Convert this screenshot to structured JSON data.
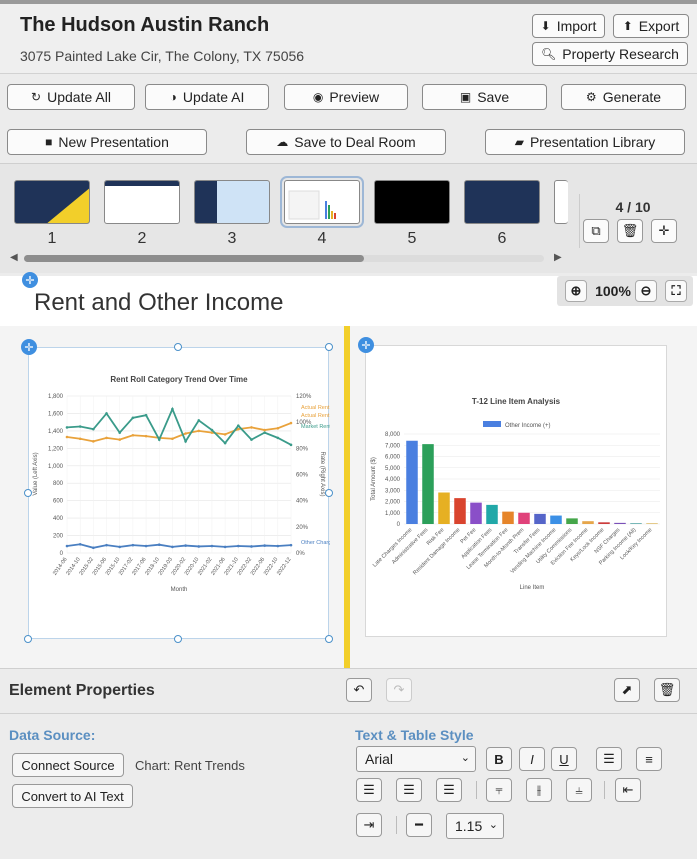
{
  "header": {
    "title": "The Hudson Austin Ranch",
    "address": "3075 Painted Lake Cir, The Colony, TX 75056",
    "import_label": "Import",
    "export_label": "Export",
    "research_label": "Property Research"
  },
  "toolbar": {
    "update_all": "Update All",
    "update_ai": "Update AI",
    "preview": "Preview",
    "save": "Save",
    "generate": "Generate",
    "new_presentation": "New Presentation",
    "save_deal_room": "Save to Deal Room",
    "presentation_library": "Presentation Library"
  },
  "thumbnails": {
    "numbers": [
      "1",
      "2",
      "3",
      "4",
      "5",
      "6"
    ],
    "selected": "4",
    "counter": "4 / 10"
  },
  "slide": {
    "title": "Rent and Other Income",
    "zoom": "100%"
  },
  "chart_data": [
    {
      "type": "line",
      "title": "Rent Roll Category Trend Over Time",
      "xlabel": "Month",
      "ylabel": "Value (Left Axis)",
      "y2label": "Rate (Right Axis)",
      "ylim": [
        0,
        1800
      ],
      "y2lim": [
        0,
        120
      ],
      "yticks": [
        "1,800",
        "1,600",
        "1,400",
        "1,200",
        "1,000",
        "800",
        "600",
        "400",
        "200",
        "0"
      ],
      "y2ticks": [
        "120%",
        "100%",
        "80%",
        "60%",
        "40%",
        "20%",
        "0%"
      ],
      "categories": [
        "2014-06",
        "2014-10",
        "2015-02",
        "2015-06",
        "2015-10",
        "2017-02",
        "2017-06",
        "2018-10",
        "2019-03",
        "2020-02",
        "2020-10",
        "2021-02",
        "2021-06",
        "2021-10",
        "2022-02",
        "2022-06",
        "2022-10",
        "2022-12"
      ],
      "series": [
        {
          "name": "Actual Rent",
          "color": "#e9a23b",
          "values": [
            1330,
            1310,
            1280,
            1320,
            1300,
            1350,
            1340,
            1320,
            1310,
            1370,
            1400,
            1380,
            1360,
            1420,
            1440,
            1410,
            1430,
            1490
          ]
        },
        {
          "name": "Market Rent",
          "color": "#3a9b8a",
          "values": [
            1440,
            1450,
            1420,
            1600,
            1380,
            1550,
            1580,
            1300,
            1650,
            1280,
            1520,
            1410,
            1260,
            1460,
            1300,
            1380,
            1320,
            1240
          ]
        },
        {
          "name": "Other Charges",
          "color": "#4a7fc1",
          "values": [
            80,
            100,
            60,
            90,
            70,
            90,
            80,
            95,
            70,
            85,
            75,
            80,
            70,
            80,
            75,
            85,
            80,
            90
          ]
        }
      ],
      "legend_right": [
        "Actual Rent",
        "Actual Rent",
        "Market Rent",
        "Other Charges"
      ]
    },
    {
      "type": "bar",
      "title": "T-12 Line Item Analysis",
      "xlabel": "Line Item",
      "ylabel": "Total Amount ($)",
      "legend": "Other Income (+)",
      "ylim": [
        0,
        8000
      ],
      "yticks": [
        "8,000",
        "7,000",
        "6,000",
        "5,000",
        "4,000",
        "3,000",
        "2,000",
        "1,000",
        "0"
      ],
      "categories": [
        "Late Charges Income",
        "Administrative Fees",
        "Risk Fee",
        "Resident Damage Income",
        "Pet Fee",
        "Application Fees",
        "Lease Termination Fee",
        "Month-to-Month Prem",
        "Transfer Fees",
        "Vending Machine Income",
        "Utility Commissions",
        "Eviction Fee Income",
        "Keys/Lock Income",
        "NSF Charges",
        "Parking Income (All)",
        "Lock/Key Income"
      ],
      "values": [
        7400,
        7100,
        2800,
        2300,
        1900,
        1700,
        1100,
        1000,
        900,
        750,
        500,
        250,
        150,
        100,
        80,
        50
      ],
      "colors": [
        "#4a7fe0",
        "#2ca05a",
        "#e6b023",
        "#d9442e",
        "#8a4fc8",
        "#21a8a8",
        "#e6852a",
        "#e0427a",
        "#5565c9",
        "#3c90e6",
        "#45a64a",
        "#e6a64a",
        "#cc3d3d",
        "#7a50b8",
        "#6ab0b0",
        "#cfa030"
      ]
    }
  ],
  "properties": {
    "title": "Element Properties",
    "data_source_label": "Data Source:",
    "connect_source": "Connect Source",
    "chart_label": "Chart: Rent Trends",
    "convert_ai": "Convert to AI Text",
    "text_style_label": "Text & Table Style",
    "font_value": "Arial",
    "line_height_value": "1.15"
  }
}
